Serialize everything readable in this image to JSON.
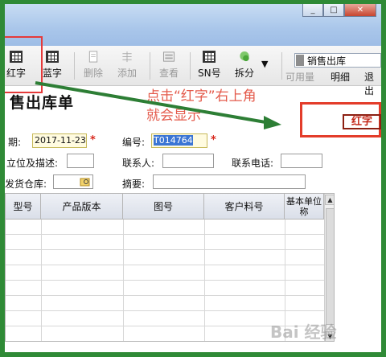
{
  "window": {
    "buttons": {
      "minimize": "_",
      "maximize": "□",
      "close": "✕"
    }
  },
  "toolbar": {
    "items": [
      {
        "label": "红字",
        "icon": "grid-icon",
        "enabled": true
      },
      {
        "label": "蓝字",
        "icon": "grid-icon",
        "enabled": true
      },
      {
        "label": "删除",
        "icon": "document-icon",
        "enabled": false
      },
      {
        "label": "添加",
        "icon": "add-icon",
        "enabled": false
      },
      {
        "label": "查看",
        "icon": "view-icon",
        "enabled": false
      },
      {
        "label": "SN号",
        "icon": "grid-icon",
        "enabled": true
      },
      {
        "label": "拆分",
        "icon": "split-icon",
        "enabled": true
      }
    ],
    "dropdown_arrow": "▼",
    "doc_type_combo": "销售出库",
    "sub_labels": [
      "可用量",
      "明细",
      "退出"
    ]
  },
  "annotation": {
    "line1": "点击“红字”右上角",
    "line2": "就会显示",
    "stamp": "红字"
  },
  "form": {
    "title": "售出库单",
    "date_label": "期:",
    "date_value": "2017-11-23",
    "number_label": "编号:",
    "number_value": "T014764",
    "unit_label": "立位及描述:",
    "contact_label": "联系人:",
    "phone_label": "联系电话:",
    "warehouse_label": "发货仓库:",
    "summary_label": "摘要:",
    "required_mark": "*"
  },
  "table": {
    "columns": [
      "型号",
      "产品版本",
      "图号",
      "客户料号",
      "基本单位\n称"
    ]
  },
  "watermark": "Bai 经验"
}
